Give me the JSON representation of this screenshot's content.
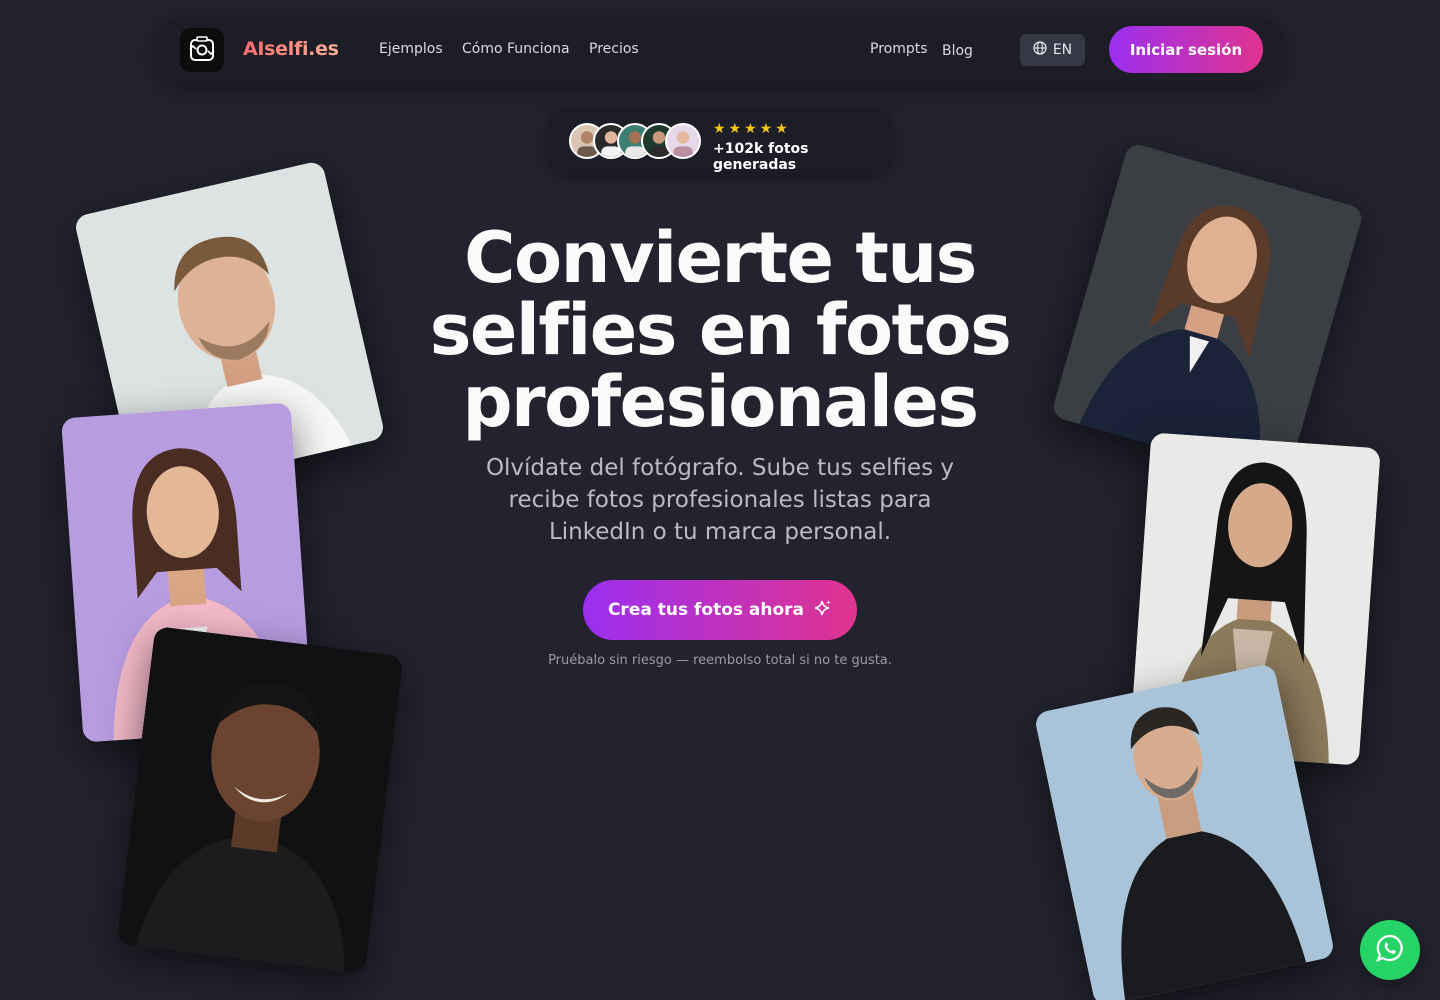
{
  "nav": {
    "brand": "AIselfi.es",
    "links": [
      "Ejemplos",
      "Cómo Funciona",
      "Precios"
    ],
    "right_links": [
      "Prompts",
      "Blog"
    ],
    "language": "EN",
    "login": "Iniciar sesión"
  },
  "badge": {
    "rating_stars": 5,
    "stars": "★★★★★",
    "text": "+102k fotos generadas"
  },
  "hero": {
    "title_line1": "Convierte tus",
    "title_line2": "selfies en fotos",
    "title_line3": "profesionales",
    "subtitle": "Olvídate del fotógrafo. Sube tus selfies y recibe fotos profesionales listas para LinkedIn o tu marca personal.",
    "cta": "Crea tus fotos ahora",
    "note": "Pruébalo sin riesgo — reembolso total si no te gusta."
  },
  "colors": {
    "background": "#22232e",
    "accent_start": "#9b2ff0",
    "accent_end": "#e0338f",
    "star": "#f5c518",
    "whatsapp": "#25d366"
  },
  "icons": [
    "camera-logo-icon",
    "globe-icon",
    "sparkle-icon",
    "whatsapp-icon"
  ]
}
